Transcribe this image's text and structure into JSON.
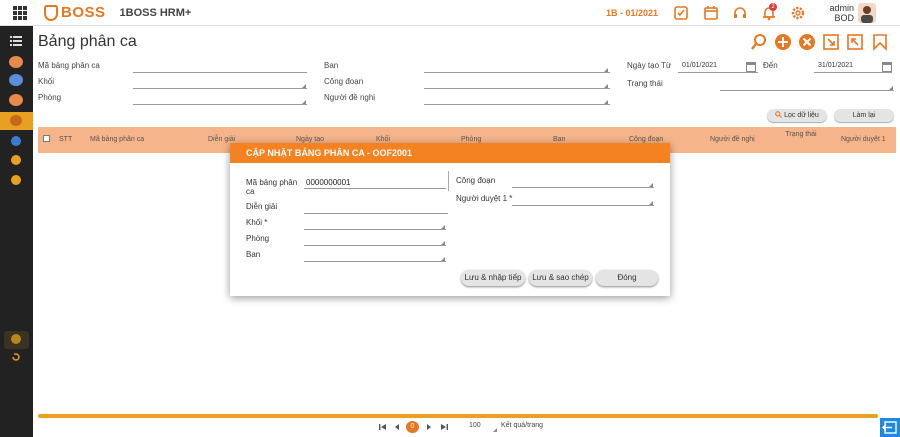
{
  "header": {
    "logo_text": "BOSS",
    "app_title": "1BOSS HRM+",
    "company": "1B - 01/2021",
    "notification_count": "2",
    "user_name": "admin",
    "user_role": "BOD"
  },
  "page": {
    "title": "Bảng phân ca"
  },
  "filters": {
    "shift_code_label": "Mã bảng phân ca",
    "block_label": "Khối",
    "room_label": "Phòng",
    "department_label": "Ban",
    "union_label": "Công đoạn",
    "proposer_label": "Người đề nghị",
    "date_from_label": "Ngày tạo Từ",
    "date_from_value": "01/01/2021",
    "date_to_label": "Đến",
    "date_to_value": "31/01/2021",
    "status_label": "Trạng thái",
    "filter_button": "Lọc dữ liệu",
    "reset_button": "Làm lại"
  },
  "table": {
    "columns": [
      "STT",
      "Mã bảng phân ca",
      "Diễn giải",
      "Ngày tạo",
      "Khối",
      "Phòng",
      "Ban",
      "Công đoạn",
      "Người đề nghị",
      "Trạng thái",
      "Người duyệt 1"
    ]
  },
  "pagination": {
    "current_page": "0",
    "page_size": "100",
    "per_page_label": "Kết quả/trang"
  },
  "modal": {
    "title": "CẬP NHẬT BẢNG PHÂN CA - OOF2001",
    "shift_code_label": "Mã bảng phân ca",
    "shift_code_value": "0000000001",
    "description_label": "Diễn giải",
    "block_label": "Khối *",
    "room_label": "Phòng",
    "department_label": "Ban",
    "union_label": "Công đoạn",
    "approver_label": "Người duyệt 1 *",
    "save_continue": "Lưu & nhập tiếp",
    "save_copy": "Lưu & sao chép",
    "close": "Đóng"
  },
  "colors": {
    "accent": "#f58220",
    "sidebar": "#222222",
    "table_header": "#f6b48a"
  }
}
